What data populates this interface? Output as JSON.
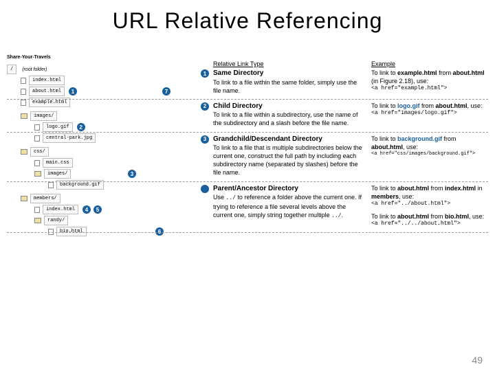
{
  "title": "URL Relative Referencing",
  "siteLabel": "Share-Your-Travels",
  "tree": {
    "root": "/",
    "rootNote": "(root folder)",
    "files": {
      "index": "index.html",
      "about": "about.html",
      "example": "example.html",
      "imagesFolder": "images/",
      "logo": "logo.gif",
      "central": "central-park.jpg",
      "cssFolder": "css/",
      "maincss": "main.css",
      "cssImagesFolder": "images/",
      "background": "background.gif",
      "membersFolder": "members/",
      "memberIndex": "index.html",
      "randyFolder": "randy/",
      "bio": "bio.html"
    }
  },
  "circles": {
    "c1": "1",
    "c2": "2",
    "c3": "3",
    "c4": "4",
    "c5": "5",
    "c6": "6",
    "c7": "7"
  },
  "headers": {
    "type": "Relative Link Type",
    "example": "Example"
  },
  "entries": [
    {
      "num": "1",
      "title": "Same Directory",
      "desc": "To link to a file within the same folder, simply use the file name.",
      "exText1": "To link to ",
      "exBold1": "example.html",
      "exText2": " from ",
      "exBold2": "about.html",
      "exText3": " (in Figure 2.18), use:",
      "code": "<a href=\"example.html\">"
    },
    {
      "num": "2",
      "title": "Child Directory",
      "desc": "To link to a file within a subdirectory, use the name of the subdirectory and a slash before the file name.",
      "exText1": "To link to ",
      "exBold1": "logo.gif",
      "exText2": " from ",
      "exBold2": "about.html",
      "exText3": ", use:",
      "code": "<a href=\"images/logo.gif\">"
    },
    {
      "num": "3",
      "title": "Grandchild/Descendant Directory",
      "desc": "To link to a file that is multiple subdirectories below the current one, construct the full path by including each subdirectory name (separated by slashes) before the file name.",
      "exText1": "To link to ",
      "exBold1": "background.gif",
      "exText2": " from ",
      "exBold2": "about.html",
      "exText3": ", use:",
      "code": "<a href=\"css/images/background.gif\">"
    },
    {
      "num": "",
      "title": "Parent/Ancestor Directory",
      "desc1": "Use ",
      "descCode1": "../",
      "desc2": " to reference a folder above the current one. If trying to reference a file several levels above the current one, simply string together multiple ",
      "descCode2": "../",
      "desc3": ".",
      "exText1": "To link to ",
      "exBold1": "about.html",
      "exText2": " from ",
      "exBold2": "index.html",
      "exText3": " in ",
      "exBold3": "members",
      "exText4": ", use:",
      "code1": "<a href=\"../about.html\">",
      "exText5": "To link to ",
      "exBold4": "about.html",
      "exText6": " from ",
      "exBold5": "bio.html",
      "exText7": ", use:",
      "code2": "<a href=\"../../about.html\">"
    }
  ],
  "pageNum": "49"
}
